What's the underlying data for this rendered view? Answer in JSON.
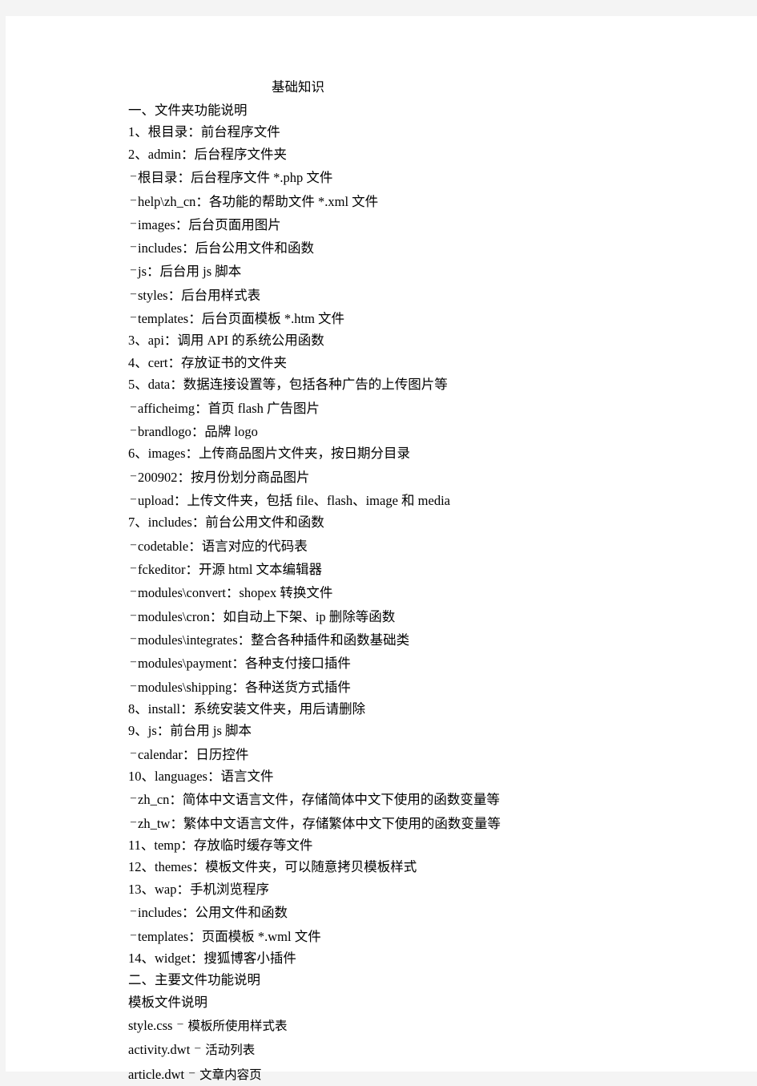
{
  "document": {
    "title": "基础知识",
    "background_color": "#f4f4f4",
    "page_color": "#ffffff",
    "text_color": "#000000",
    "sections": [
      {
        "level": 0,
        "text": "一、文件夹功能说明"
      },
      {
        "level": 0,
        "text": "1、根目录：前台程序文件"
      },
      {
        "level": 0,
        "text": "2、admin：后台程序文件夹"
      },
      {
        "level": 1,
        "text": "根目录：后台程序文件 *.php 文件"
      },
      {
        "level": 1,
        "text": "help\\zh_cn：各功能的帮助文件 *.xml 文件"
      },
      {
        "level": 1,
        "text": "images：后台页面用图片"
      },
      {
        "level": 1,
        "text": "includes：后台公用文件和函数"
      },
      {
        "level": 1,
        "text": "js：后台用 js 脚本"
      },
      {
        "level": 1,
        "text": "styles：后台用样式表"
      },
      {
        "level": 1,
        "text": "templates：后台页面模板 *.htm 文件"
      },
      {
        "level": 0,
        "text": "3、api：调用 API 的系统公用函数"
      },
      {
        "level": 0,
        "text": "4、cert：存放证书的文件夹"
      },
      {
        "level": 0,
        "text": "5、data：数据连接设置等，包括各种广告的上传图片等"
      },
      {
        "level": 1,
        "text": "afficheimg：首页 flash 广告图片"
      },
      {
        "level": 1,
        "text": "brandlogo：品牌 logo"
      },
      {
        "level": 0,
        "text": "6、images：上传商品图片文件夹，按日期分目录"
      },
      {
        "level": 1,
        "text": "200902：按月份划分商品图片"
      },
      {
        "level": 1,
        "text": "upload：上传文件夹，包括 file、flash、image 和 media"
      },
      {
        "level": 0,
        "text": "7、includes：前台公用文件和函数"
      },
      {
        "level": 1,
        "text": "codetable：语言对应的代码表"
      },
      {
        "level": 1,
        "text": "fckeditor：开源 html 文本编辑器"
      },
      {
        "level": 1,
        "text": "modules\\convert：shopex 转换文件"
      },
      {
        "level": 1,
        "text": "modules\\cron：如自动上下架、ip 删除等函数"
      },
      {
        "level": 1,
        "text": "modules\\integrates：整合各种插件和函数基础类"
      },
      {
        "level": 1,
        "text": "modules\\payment：各种支付接口插件"
      },
      {
        "level": 1,
        "text": "modules\\shipping：各种送货方式插件"
      },
      {
        "level": 0,
        "text": "8、install：系统安装文件夹，用后请删除"
      },
      {
        "level": 0,
        "text": "9、js：前台用 js 脚本"
      },
      {
        "level": 1,
        "text": "calendar：日历控件"
      },
      {
        "level": 0,
        "text": "10、languages：语言文件"
      },
      {
        "level": 1,
        "text": "zh_cn：简体中文语言文件，存储简体中文下使用的函数变量等"
      },
      {
        "level": 1,
        "text": "zh_tw：繁体中文语言文件，存储繁体中文下使用的函数变量等"
      },
      {
        "level": 0,
        "text": "11、temp：存放临时缓存等文件"
      },
      {
        "level": 0,
        "text": "12、themes：模板文件夹，可以随意拷贝模板样式"
      },
      {
        "level": 0,
        "text": "13、wap：手机浏览程序"
      },
      {
        "level": 1,
        "text": "includes：公用文件和函数"
      },
      {
        "level": 1,
        "text": "templates：页面模板 *.wml 文件"
      },
      {
        "level": 0,
        "text": "14、widget：搜狐博客小插件"
      },
      {
        "level": 0,
        "text": "二、主要文件功能说明"
      },
      {
        "level": 0,
        "text": "模板文件说明"
      },
      {
        "level": "file",
        "name": "style.css",
        "desc": "模板所使用样式表"
      },
      {
        "level": "file",
        "name": "activity.dwt",
        "desc": "活动列表"
      },
      {
        "level": "file",
        "name": "article.dwt",
        "desc": "文章内容页"
      }
    ]
  }
}
